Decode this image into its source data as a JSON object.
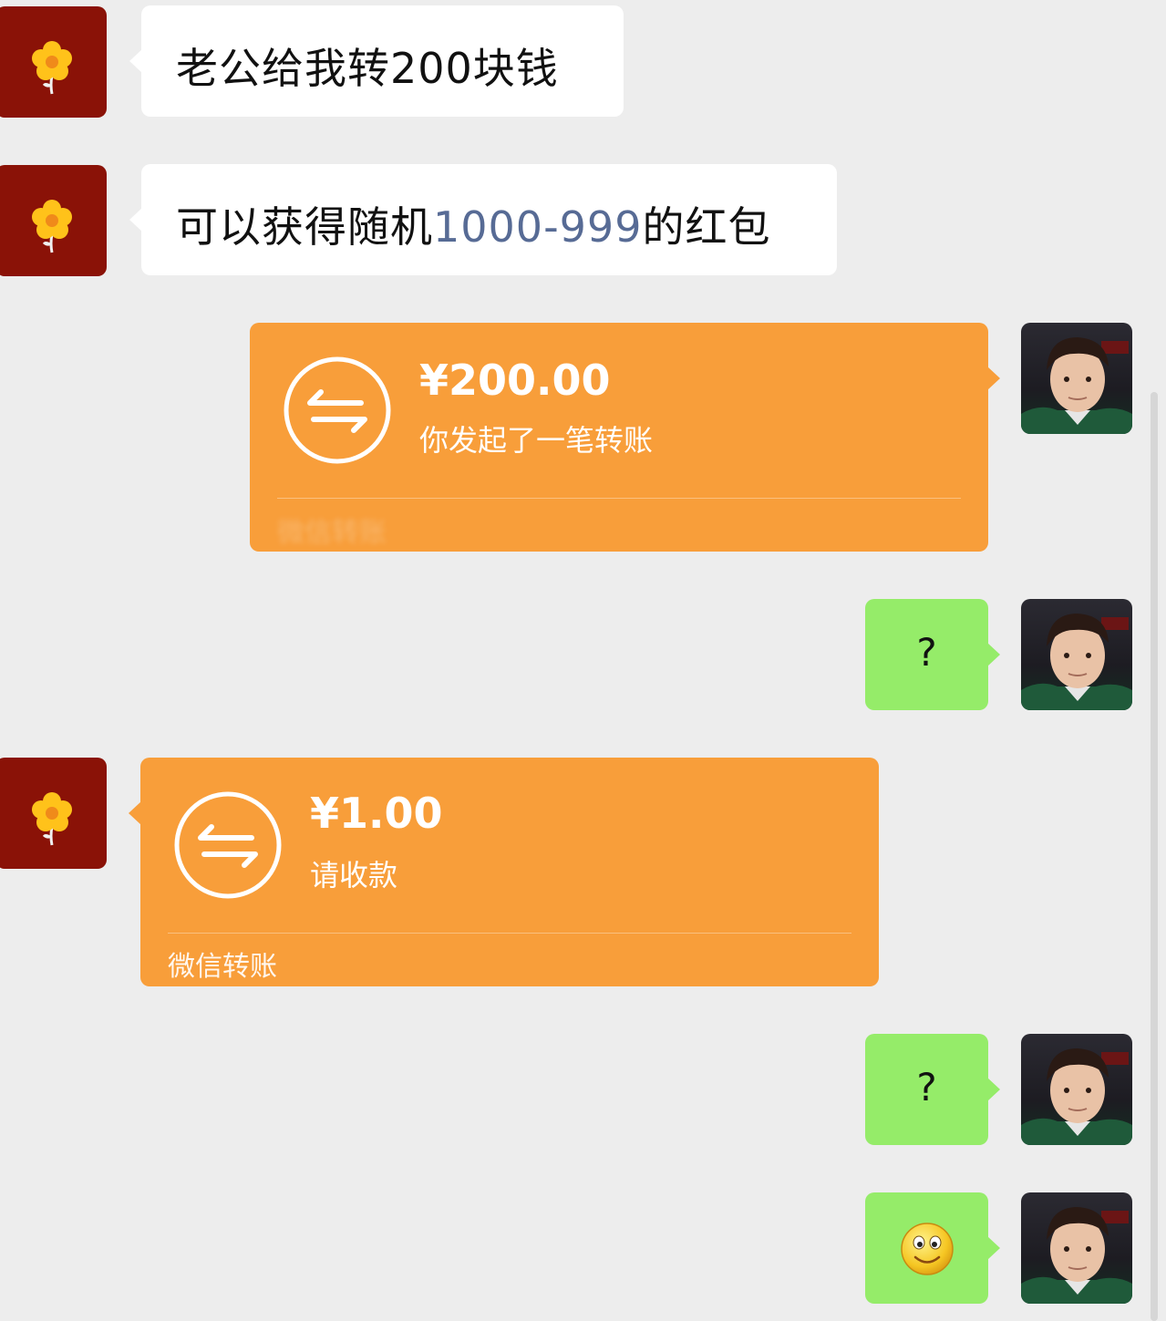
{
  "messages": [
    {
      "side": "left",
      "type": "text",
      "text_before": "老公给我转200块钱"
    },
    {
      "side": "left",
      "type": "text",
      "text_before": "可以获得随机",
      "link": "1000-999",
      "text_after": "的红包"
    },
    {
      "side": "right",
      "type": "transfer",
      "amount": "¥200.00",
      "subtitle": "你发起了一笔转账",
      "footer": "微信转账"
    },
    {
      "side": "right",
      "type": "text",
      "text": "?"
    },
    {
      "side": "left",
      "type": "transfer",
      "amount": "¥1.00",
      "subtitle": "请收款",
      "footer": "微信转账"
    },
    {
      "side": "right",
      "type": "text",
      "text": "?"
    },
    {
      "side": "right",
      "type": "emoji",
      "emoji": "smile-emoji"
    }
  ],
  "avatars": {
    "left": "flower-avatar",
    "right": "selfie-avatar"
  },
  "colors": {
    "background": "#ededed",
    "green_bubble": "#95ec69",
    "transfer_orange": "#f89e3a",
    "link": "#576b95",
    "avatar_left_bg": "#8a1207"
  }
}
